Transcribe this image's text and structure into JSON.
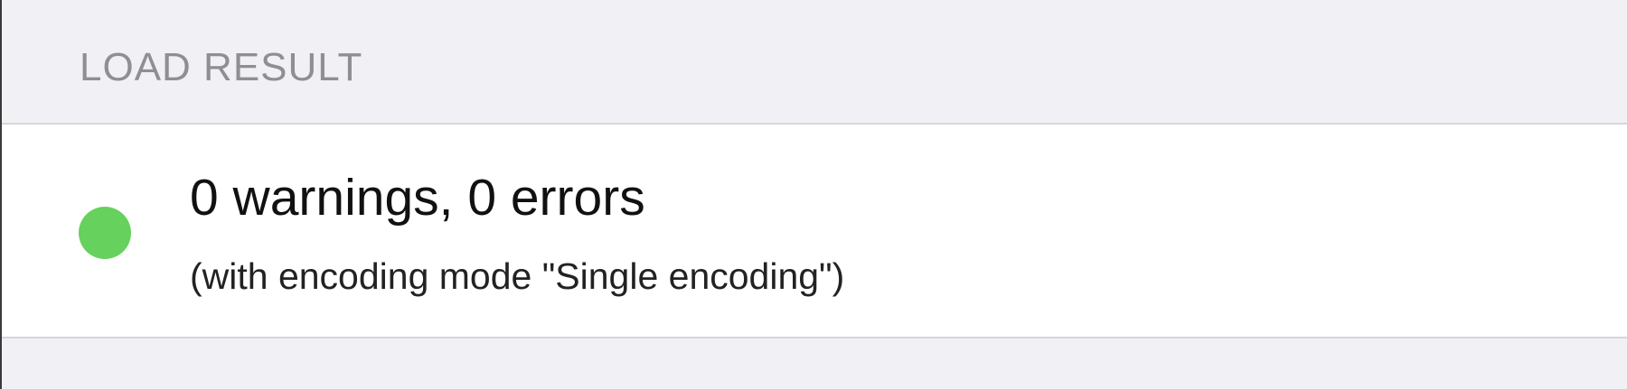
{
  "section": {
    "header": "LOAD RESULT"
  },
  "result": {
    "status_icon": "green-status-dot",
    "status_color": "#66d15c",
    "title": "0 warnings, 0 errors",
    "subtitle": "(with encoding mode \"Single encoding\")"
  }
}
